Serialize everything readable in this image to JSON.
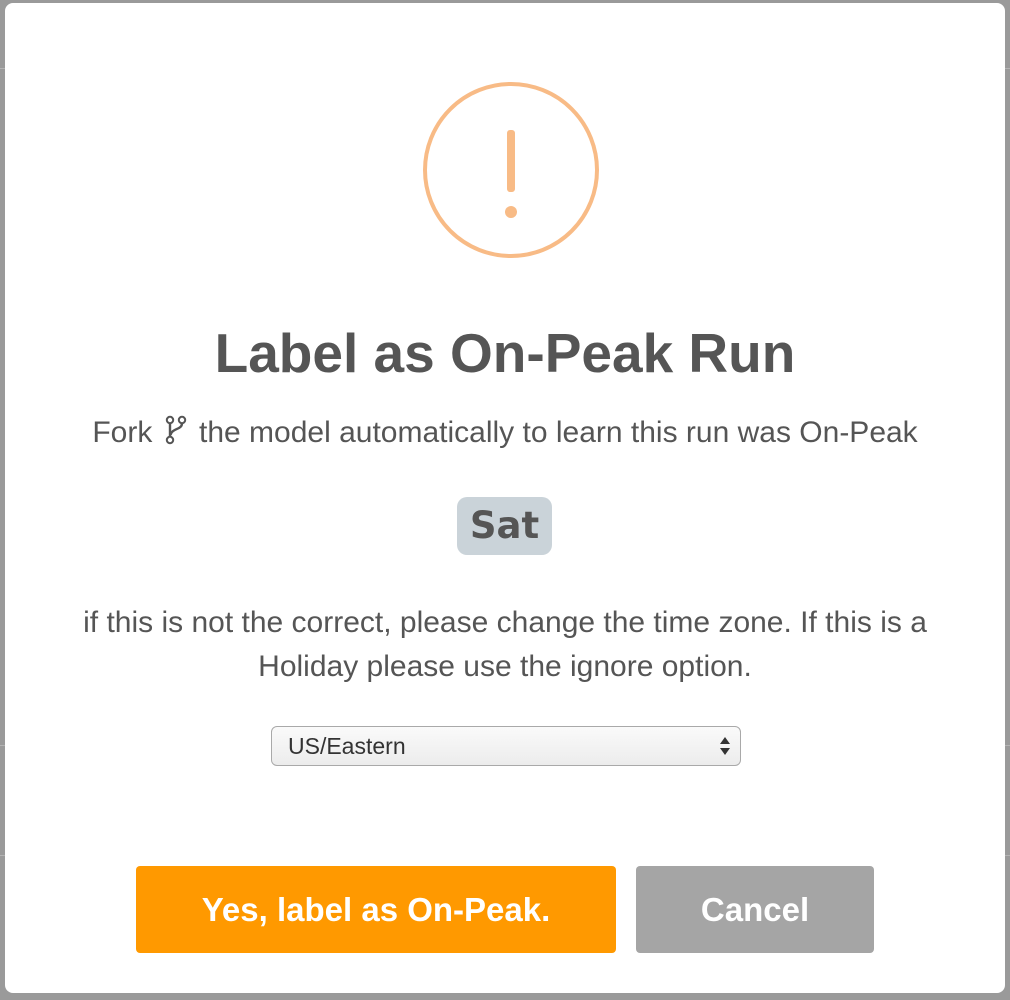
{
  "dialog": {
    "title": "Label as On-Peak Run",
    "subtitle_before": "Fork",
    "subtitle_after": "the model automatically to learn this run was On-Peak",
    "fork_icon": "code-fork-icon",
    "warning_icon": "exclamation-circle-icon",
    "day_badge": "Sat",
    "note": "if this is not the correct, please change the time zone. If this is a Holiday please use the ignore option.",
    "timezone_select": {
      "value": "US/Eastern"
    },
    "confirm_label": "Yes, label as On-Peak.",
    "cancel_label": "Cancel"
  },
  "colors": {
    "warning": "#f8bb86",
    "confirm": "#ff9900",
    "cancel": "#a5a5a5",
    "badge": "#cad3d9",
    "text": "#555555"
  }
}
